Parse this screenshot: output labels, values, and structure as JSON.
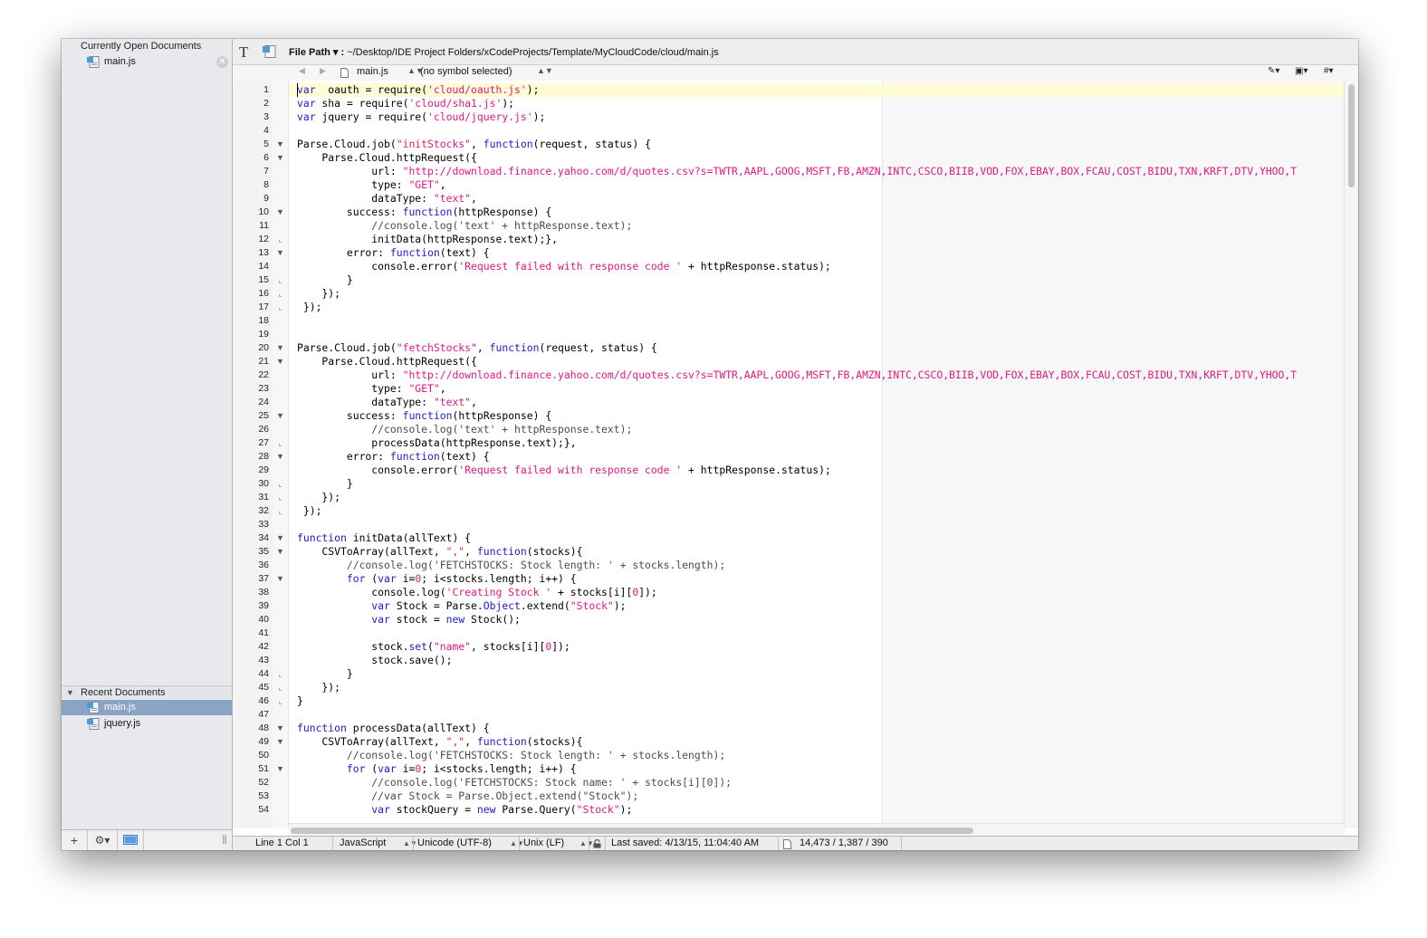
{
  "sidebar": {
    "open_header": "Currently Open Documents",
    "open_items": [
      {
        "label": "main.js"
      }
    ],
    "recent_header": "Recent Documents",
    "recent_items": [
      {
        "label": "main.js",
        "selected": true
      },
      {
        "label": "jquery.js",
        "selected": false
      }
    ],
    "bottom_buttons": [
      {
        "label": "+",
        "icon": "plus-icon"
      },
      {
        "label": "⚙▾",
        "icon": "gear-icon"
      },
      {
        "label": "",
        "icon": "sidebar-toggle-icon"
      }
    ]
  },
  "toolbar": {
    "text_icon": "T",
    "file_path_label": "File Path ▾ :",
    "file_path": "~/Desktop/IDE Project Folders/xCodeProjects/Template/MyCloudCode/cloud/main.js"
  },
  "navbar": {
    "file": "main.js",
    "symbol": "(no symbol selected)",
    "right_tools": [
      "✎▾",
      "▣▾",
      "#▾"
    ]
  },
  "status": {
    "position": "Line 1 Col 1",
    "language": "JavaScript",
    "encoding": "Unicode (UTF-8)",
    "line_endings": "Unix (LF)",
    "last_saved": "Last saved: 4/13/15, 11:04:40 AM",
    "counts": "14,473 / 1,387 / 390"
  },
  "colors": {
    "keyword": "#1b1bcc",
    "string": "#e3177f",
    "comment": "#4c4c4c",
    "selection": "#8ba3c4",
    "current_line": "#fffbd5"
  },
  "code_lines": [
    {
      "n": 1,
      "fold": "",
      "segs": [
        [
          "kw",
          "var"
        ],
        [
          "",
          "  oauth = require("
        ],
        [
          "str",
          "'cloud/oauth.js'"
        ],
        [
          "",
          ");"
        ]
      ]
    },
    {
      "n": 2,
      "fold": "",
      "segs": [
        [
          "kw",
          "var"
        ],
        [
          "",
          " sha = require("
        ],
        [
          "str",
          "'cloud/sha1.js'"
        ],
        [
          "",
          ");"
        ]
      ]
    },
    {
      "n": 3,
      "fold": "",
      "segs": [
        [
          "kw",
          "var"
        ],
        [
          "",
          " jquery = require("
        ],
        [
          "str",
          "'cloud/jquery.js'"
        ],
        [
          "",
          ");"
        ]
      ]
    },
    {
      "n": 4,
      "fold": "",
      "segs": []
    },
    {
      "n": 5,
      "fold": "open",
      "segs": [
        [
          "",
          "Parse.Cloud.job("
        ],
        [
          "str",
          "\"initStocks\""
        ],
        [
          "",
          ", "
        ],
        [
          "kw",
          "function"
        ],
        [
          "",
          "(request, status) {"
        ]
      ]
    },
    {
      "n": 6,
      "fold": "open",
      "segs": [
        [
          "",
          "    Parse.Cloud.httpRequest({"
        ]
      ]
    },
    {
      "n": 7,
      "fold": "",
      "segs": [
        [
          "",
          "            url: "
        ],
        [
          "str",
          "\"http://download.finance.yahoo.com/d/quotes.csv?s=TWTR,AAPL,GOOG,MSFT,FB,AMZN,INTC,CSCO,BIIB,VOD,FOX,EBAY,BOX,FCAU,COST,BIDU,TXN,KRFT,DTV,YHOO,T"
        ]
      ]
    },
    {
      "n": 8,
      "fold": "",
      "segs": [
        [
          "",
          "            type: "
        ],
        [
          "str",
          "\"GET\""
        ],
        [
          "",
          ","
        ]
      ]
    },
    {
      "n": 9,
      "fold": "",
      "segs": [
        [
          "",
          "            dataType: "
        ],
        [
          "str",
          "\"text\""
        ],
        [
          "",
          ","
        ]
      ]
    },
    {
      "n": 10,
      "fold": "open",
      "segs": [
        [
          "",
          "        success: "
        ],
        [
          "kw",
          "function"
        ],
        [
          "",
          "(httpResponse) {"
        ]
      ]
    },
    {
      "n": 11,
      "fold": "",
      "segs": [
        [
          "cmt",
          "            //console.log('text' + httpResponse.text);"
        ]
      ]
    },
    {
      "n": 12,
      "fold": "end",
      "segs": [
        [
          "",
          "            initData(httpResponse.text);},"
        ]
      ]
    },
    {
      "n": 13,
      "fold": "open",
      "segs": [
        [
          "",
          "        error: "
        ],
        [
          "kw",
          "function"
        ],
        [
          "",
          "(text) {"
        ]
      ]
    },
    {
      "n": 14,
      "fold": "",
      "segs": [
        [
          "",
          "            console.error("
        ],
        [
          "str",
          "'Request failed with response code '"
        ],
        [
          "",
          " + httpResponse.status);"
        ]
      ]
    },
    {
      "n": 15,
      "fold": "end",
      "segs": [
        [
          "",
          "        }"
        ]
      ]
    },
    {
      "n": 16,
      "fold": "end",
      "segs": [
        [
          "",
          "    });"
        ]
      ]
    },
    {
      "n": 17,
      "fold": "end",
      "segs": [
        [
          "",
          " });"
        ]
      ]
    },
    {
      "n": 18,
      "fold": "",
      "segs": []
    },
    {
      "n": 19,
      "fold": "",
      "segs": []
    },
    {
      "n": 20,
      "fold": "open",
      "segs": [
        [
          "",
          "Parse.Cloud.job("
        ],
        [
          "str",
          "\"fetchStocks\""
        ],
        [
          "",
          ", "
        ],
        [
          "kw",
          "function"
        ],
        [
          "",
          "(request, status) {"
        ]
      ]
    },
    {
      "n": 21,
      "fold": "open",
      "segs": [
        [
          "",
          "    Parse.Cloud.httpRequest({"
        ]
      ]
    },
    {
      "n": 22,
      "fold": "",
      "segs": [
        [
          "",
          "            url: "
        ],
        [
          "str",
          "\"http://download.finance.yahoo.com/d/quotes.csv?s=TWTR,AAPL,GOOG,MSFT,FB,AMZN,INTC,CSCO,BIIB,VOD,FOX,EBAY,BOX,FCAU,COST,BIDU,TXN,KRFT,DTV,YHOO,T"
        ]
      ]
    },
    {
      "n": 23,
      "fold": "",
      "segs": [
        [
          "",
          "            type: "
        ],
        [
          "str",
          "\"GET\""
        ],
        [
          "",
          ","
        ]
      ]
    },
    {
      "n": 24,
      "fold": "",
      "segs": [
        [
          "",
          "            dataType: "
        ],
        [
          "str",
          "\"text\""
        ],
        [
          "",
          ","
        ]
      ]
    },
    {
      "n": 25,
      "fold": "open",
      "segs": [
        [
          "",
          "        success: "
        ],
        [
          "kw",
          "function"
        ],
        [
          "",
          "(httpResponse) {"
        ]
      ]
    },
    {
      "n": 26,
      "fold": "",
      "segs": [
        [
          "cmt",
          "            //console.log('text' + httpResponse.text);"
        ]
      ]
    },
    {
      "n": 27,
      "fold": "end",
      "segs": [
        [
          "",
          "            processData(httpResponse.text);},"
        ]
      ]
    },
    {
      "n": 28,
      "fold": "open",
      "segs": [
        [
          "",
          "        error: "
        ],
        [
          "kw",
          "function"
        ],
        [
          "",
          "(text) {"
        ]
      ]
    },
    {
      "n": 29,
      "fold": "",
      "segs": [
        [
          "",
          "            console.error("
        ],
        [
          "str",
          "'Request failed with response code '"
        ],
        [
          "",
          " + httpResponse.status);"
        ]
      ]
    },
    {
      "n": 30,
      "fold": "end",
      "segs": [
        [
          "",
          "        }"
        ]
      ]
    },
    {
      "n": 31,
      "fold": "end",
      "segs": [
        [
          "",
          "    });"
        ]
      ]
    },
    {
      "n": 32,
      "fold": "end",
      "segs": [
        [
          "",
          " });"
        ]
      ]
    },
    {
      "n": 33,
      "fold": "",
      "segs": []
    },
    {
      "n": 34,
      "fold": "open",
      "segs": [
        [
          "kw",
          "function"
        ],
        [
          "",
          " initData(allText) {"
        ]
      ]
    },
    {
      "n": 35,
      "fold": "open",
      "segs": [
        [
          "",
          "    CSVToArray(allText, "
        ],
        [
          "str",
          "\",\""
        ],
        [
          "",
          ", "
        ],
        [
          "kw",
          "function"
        ],
        [
          "",
          "(stocks){"
        ]
      ]
    },
    {
      "n": 36,
      "fold": "",
      "segs": [
        [
          "cmt",
          "        //console.log('FETCHSTOCKS: Stock length: ' + stocks.length);"
        ]
      ]
    },
    {
      "n": 37,
      "fold": "open",
      "segs": [
        [
          "",
          "        "
        ],
        [
          "kw",
          "for"
        ],
        [
          "",
          " ("
        ],
        [
          "kw",
          "var"
        ],
        [
          "",
          " i="
        ],
        [
          "str",
          "0"
        ],
        [
          "",
          "; i<stocks.length; i++) {"
        ]
      ]
    },
    {
      "n": 38,
      "fold": "",
      "segs": [
        [
          "",
          "            console.log("
        ],
        [
          "str",
          "'Creating Stock '"
        ],
        [
          "",
          " + stocks[i]["
        ],
        [
          "str",
          "0"
        ],
        [
          "",
          "]);"
        ]
      ]
    },
    {
      "n": 39,
      "fold": "",
      "segs": [
        [
          "",
          "            "
        ],
        [
          "kw",
          "var"
        ],
        [
          "",
          " Stock = Parse."
        ],
        [
          "kw",
          "Object"
        ],
        [
          "",
          ".extend("
        ],
        [
          "str",
          "\"Stock\""
        ],
        [
          "",
          ");"
        ]
      ]
    },
    {
      "n": 40,
      "fold": "",
      "segs": [
        [
          "",
          "            "
        ],
        [
          "kw",
          "var"
        ],
        [
          "",
          " stock = "
        ],
        [
          "kw",
          "new"
        ],
        [
          "",
          " Stock();"
        ]
      ]
    },
    {
      "n": 41,
      "fold": "",
      "segs": []
    },
    {
      "n": 42,
      "fold": "",
      "segs": [
        [
          "",
          "            stock."
        ],
        [
          "kw",
          "set"
        ],
        [
          "",
          "("
        ],
        [
          "str",
          "\"name\""
        ],
        [
          "",
          ", stocks[i]["
        ],
        [
          "str",
          "0"
        ],
        [
          "",
          "]);"
        ]
      ]
    },
    {
      "n": 43,
      "fold": "",
      "segs": [
        [
          "",
          "            stock.save();"
        ]
      ]
    },
    {
      "n": 44,
      "fold": "end",
      "segs": [
        [
          "",
          "        }"
        ]
      ]
    },
    {
      "n": 45,
      "fold": "end",
      "segs": [
        [
          "",
          "    });"
        ]
      ]
    },
    {
      "n": 46,
      "fold": "end",
      "segs": [
        [
          "",
          "}"
        ]
      ]
    },
    {
      "n": 47,
      "fold": "",
      "segs": []
    },
    {
      "n": 48,
      "fold": "open",
      "segs": [
        [
          "kw",
          "function"
        ],
        [
          "",
          " processData(allText) {"
        ]
      ]
    },
    {
      "n": 49,
      "fold": "open",
      "segs": [
        [
          "",
          "    CSVToArray(allText, "
        ],
        [
          "str",
          "\",\""
        ],
        [
          "",
          ", "
        ],
        [
          "kw",
          "function"
        ],
        [
          "",
          "(stocks){"
        ]
      ]
    },
    {
      "n": 50,
      "fold": "",
      "segs": [
        [
          "cmt",
          "        //console.log('FETCHSTOCKS: Stock length: ' + stocks.length);"
        ]
      ]
    },
    {
      "n": 51,
      "fold": "open",
      "segs": [
        [
          "",
          "        "
        ],
        [
          "kw",
          "for"
        ],
        [
          "",
          " ("
        ],
        [
          "kw",
          "var"
        ],
        [
          "",
          " i="
        ],
        [
          "str",
          "0"
        ],
        [
          "",
          "; i<stocks.length; i++) {"
        ]
      ]
    },
    {
      "n": 52,
      "fold": "",
      "segs": [
        [
          "cmt",
          "            //console.log('FETCHSTOCKS: Stock name: ' + stocks[i][0]);"
        ]
      ]
    },
    {
      "n": 53,
      "fold": "",
      "segs": [
        [
          "cmt",
          "            //var Stock = Parse.Object.extend(\"Stock\");"
        ]
      ]
    },
    {
      "n": 54,
      "fold": "",
      "segs": [
        [
          "",
          "            "
        ],
        [
          "kw",
          "var"
        ],
        [
          "",
          " stockQuery = "
        ],
        [
          "kw",
          "new"
        ],
        [
          "",
          " Parse.Query("
        ],
        [
          "str",
          "\"Stock\""
        ],
        [
          "",
          ");"
        ]
      ]
    }
  ]
}
